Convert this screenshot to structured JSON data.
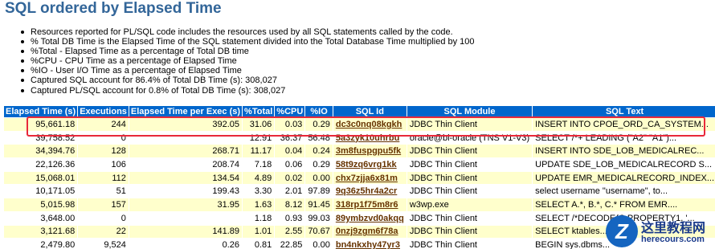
{
  "title": "SQL ordered by Elapsed Time",
  "notes": [
    "Resources reported for PL/SQL code includes the resources used by all SQL statements called by the code.",
    "% Total DB Time is the Elapsed Time of the SQL statement divided into the Total Database Time multiplied by 100",
    "%Total - Elapsed Time as a percentage of Total DB time",
    "%CPU - CPU Time as a percentage of Elapsed Time",
    "%IO - User I/O Time as a percentage of Elapsed Time",
    "Captured SQL account for 86.4% of Total DB Time (s): 308,027",
    "Captured PL/SQL account for 0.8% of Total DB Time (s): 308,027"
  ],
  "table": {
    "headers": [
      "Elapsed Time (s)",
      "Executions",
      "Elapsed Time per Exec (s)",
      "%Total",
      "%CPU",
      "%IO",
      "SQL Id",
      "SQL Module",
      "SQL Text"
    ],
    "rows": [
      [
        "95,661.18",
        "244",
        "392.05",
        "31.06",
        "0.03",
        "0.29",
        "dc3c0nq08kgkh",
        "JDBC Thin Client",
        "INSERT INTO CPOE_ORD_CA_SYSTEM..."
      ],
      [
        "39,758.52",
        "0",
        "",
        "12.91",
        "36.37",
        "56.48",
        "5a3zyk10uhrbu",
        "oracle@bi-oracle (TNS V1-V3)",
        "SELECT /*+ LEADING (\"A2\" \"A1\")..."
      ],
      [
        "34,394.76",
        "128",
        "268.71",
        "11.17",
        "0.04",
        "0.24",
        "3m8fuspgpu5fk",
        "JDBC Thin Client",
        "INSERT INTO SDE_LOB_MEDICALREC..."
      ],
      [
        "22,126.36",
        "106",
        "208.74",
        "7.18",
        "0.06",
        "0.29",
        "58t9zq6vrg1kk",
        "JDBC Thin Client",
        "UPDATE SDE_LOB_MEDICALRECORD S..."
      ],
      [
        "15,068.01",
        "112",
        "134.54",
        "4.89",
        "0.02",
        "0.00",
        "chx7zjja6x81m",
        "JDBC Thin Client",
        "UPDATE EMR_MEDICALRECORD_INDEX..."
      ],
      [
        "10,171.05",
        "51",
        "199.43",
        "3.30",
        "2.01",
        "97.89",
        "9q36z5hr4a2cr",
        "JDBC Thin Client",
        "select username \"username\", to..."
      ],
      [
        "5,015.98",
        "157",
        "31.95",
        "1.63",
        "8.12",
        "91.45",
        "318rp1f75m8r6",
        "w3wp.exe",
        "SELECT A.*, B.*, C.* FROM EMR...."
      ],
      [
        "3,648.00",
        "0",
        "",
        "1.18",
        "0.93",
        "99.03",
        "89ymbzvd0akqq",
        "JDBC Thin Client",
        "SELECT /*DECODE(C.PROPERTY1, '..."
      ],
      [
        "3,121.68",
        "22",
        "141.89",
        "1.01",
        "2.55",
        "70.67",
        "0nzj9zgm6f78a",
        "JDBC Thin Client",
        "SELECT ktables..."
      ],
      [
        "2,479.80",
        "9,524",
        "0.26",
        "0.81",
        "22.85",
        "0.00",
        "bn4nkxhy47yr3",
        "JDBC Thin Client",
        "BEGIN sys.dbms..."
      ]
    ]
  },
  "watermark": {
    "logo_letter": "Z",
    "text_cn": "这里教程网",
    "text_url": "herecours.com",
    "color": "#1565c0"
  },
  "colors": {
    "title": "#336699",
    "header_bg": "#0066cc",
    "row_alt": "#ffffcc",
    "highlight": "#e8283a"
  }
}
